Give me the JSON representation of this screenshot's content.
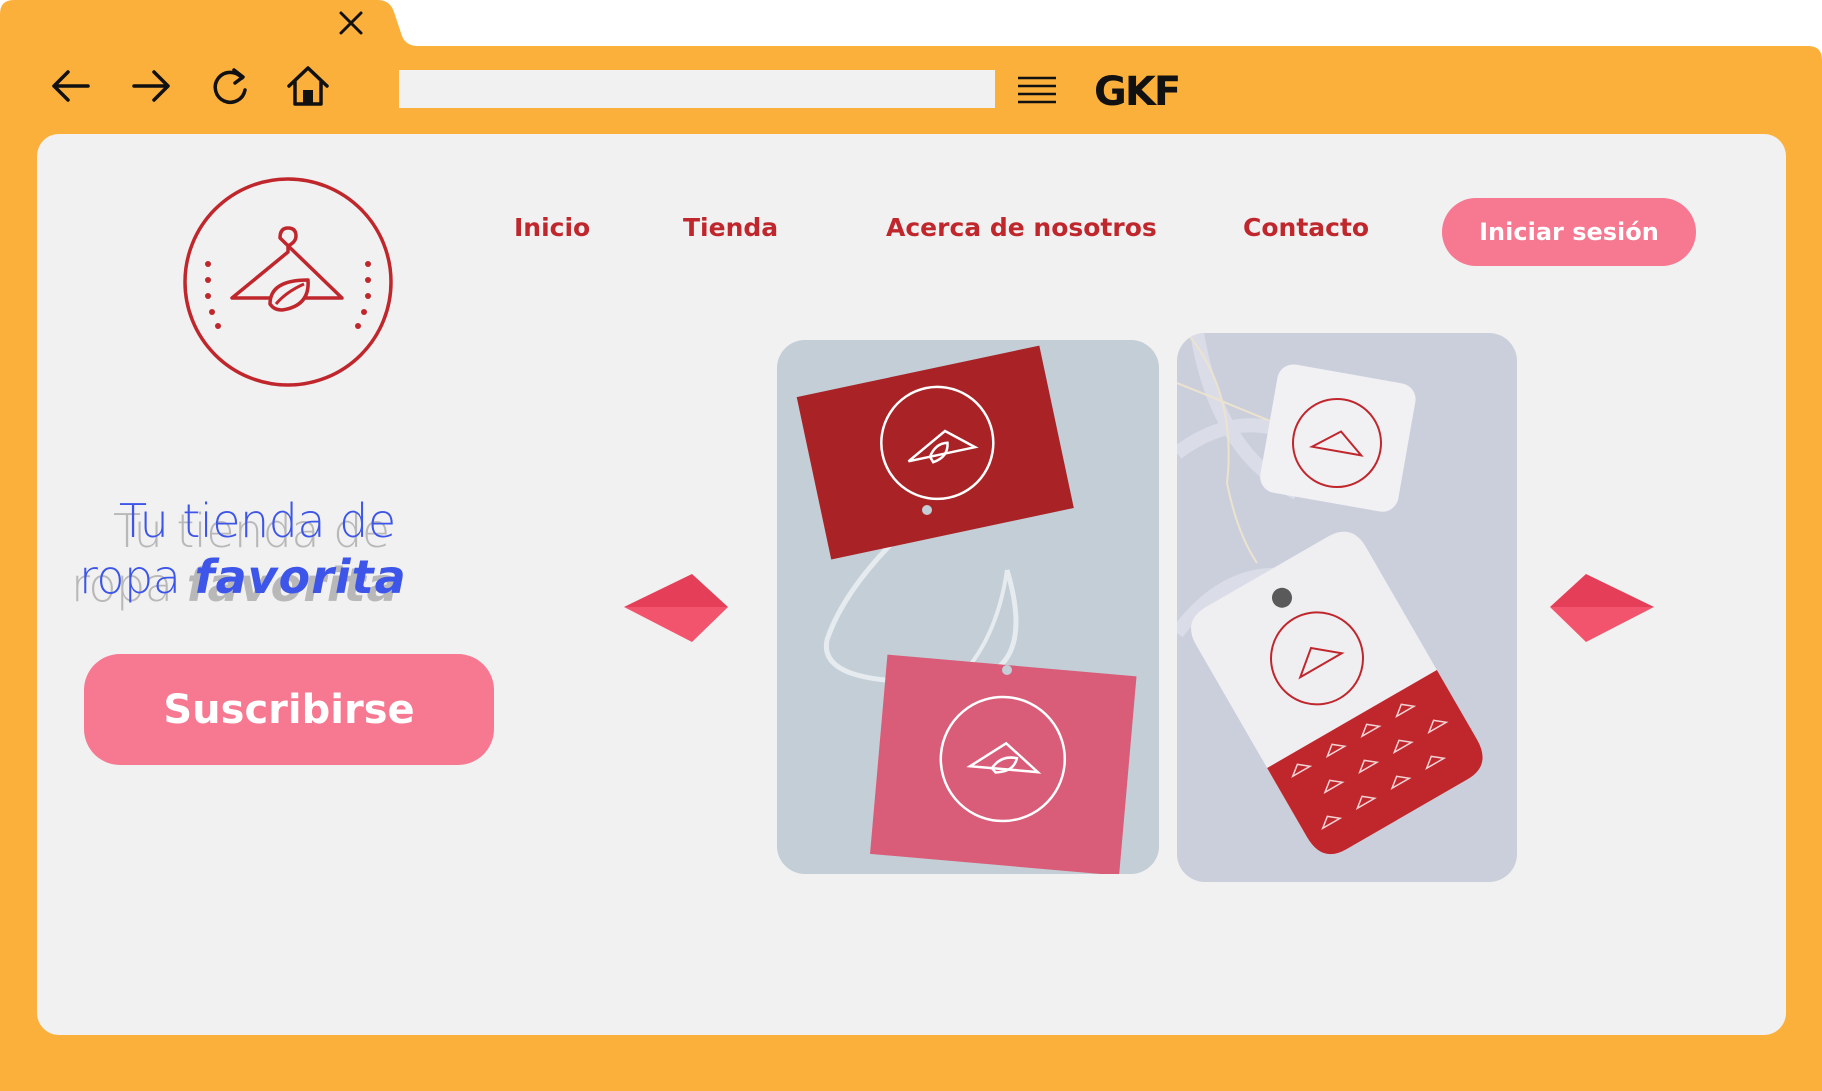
{
  "browser": {
    "brand": "GKF",
    "url_value": "",
    "icons": [
      "close-icon",
      "back-arrow-icon",
      "forward-arrow-icon",
      "reload-icon",
      "home-icon",
      "menu-icon"
    ],
    "frame_color": "#fbb03b"
  },
  "site": {
    "logo_icon": "hanger-leaf-logo",
    "nav": {
      "items": [
        {
          "label": "Inicio"
        },
        {
          "label": "Tienda"
        },
        {
          "label": "Acerca de nosotros"
        },
        {
          "label": "Contacto"
        }
      ],
      "login_label": "Iniciar sesión"
    },
    "hero": {
      "line1": "Tu tienda de",
      "line2_plain": "ropa",
      "line2_emphasis": "favorita",
      "subscribe_label": "Suscribirse"
    },
    "carousel": {
      "prev_icon": "arrow-left-icon",
      "next_icon": "arrow-right-icon",
      "images": [
        {
          "name": "hang-tags-red-pink-photo"
        },
        {
          "name": "hang-tags-white-pattern-photo"
        }
      ]
    },
    "colors": {
      "brand_red": "#c0272d",
      "accent_pink": "#f67891",
      "headline_blue": "#3d55e8",
      "page_bg": "#f1f1f1"
    }
  }
}
